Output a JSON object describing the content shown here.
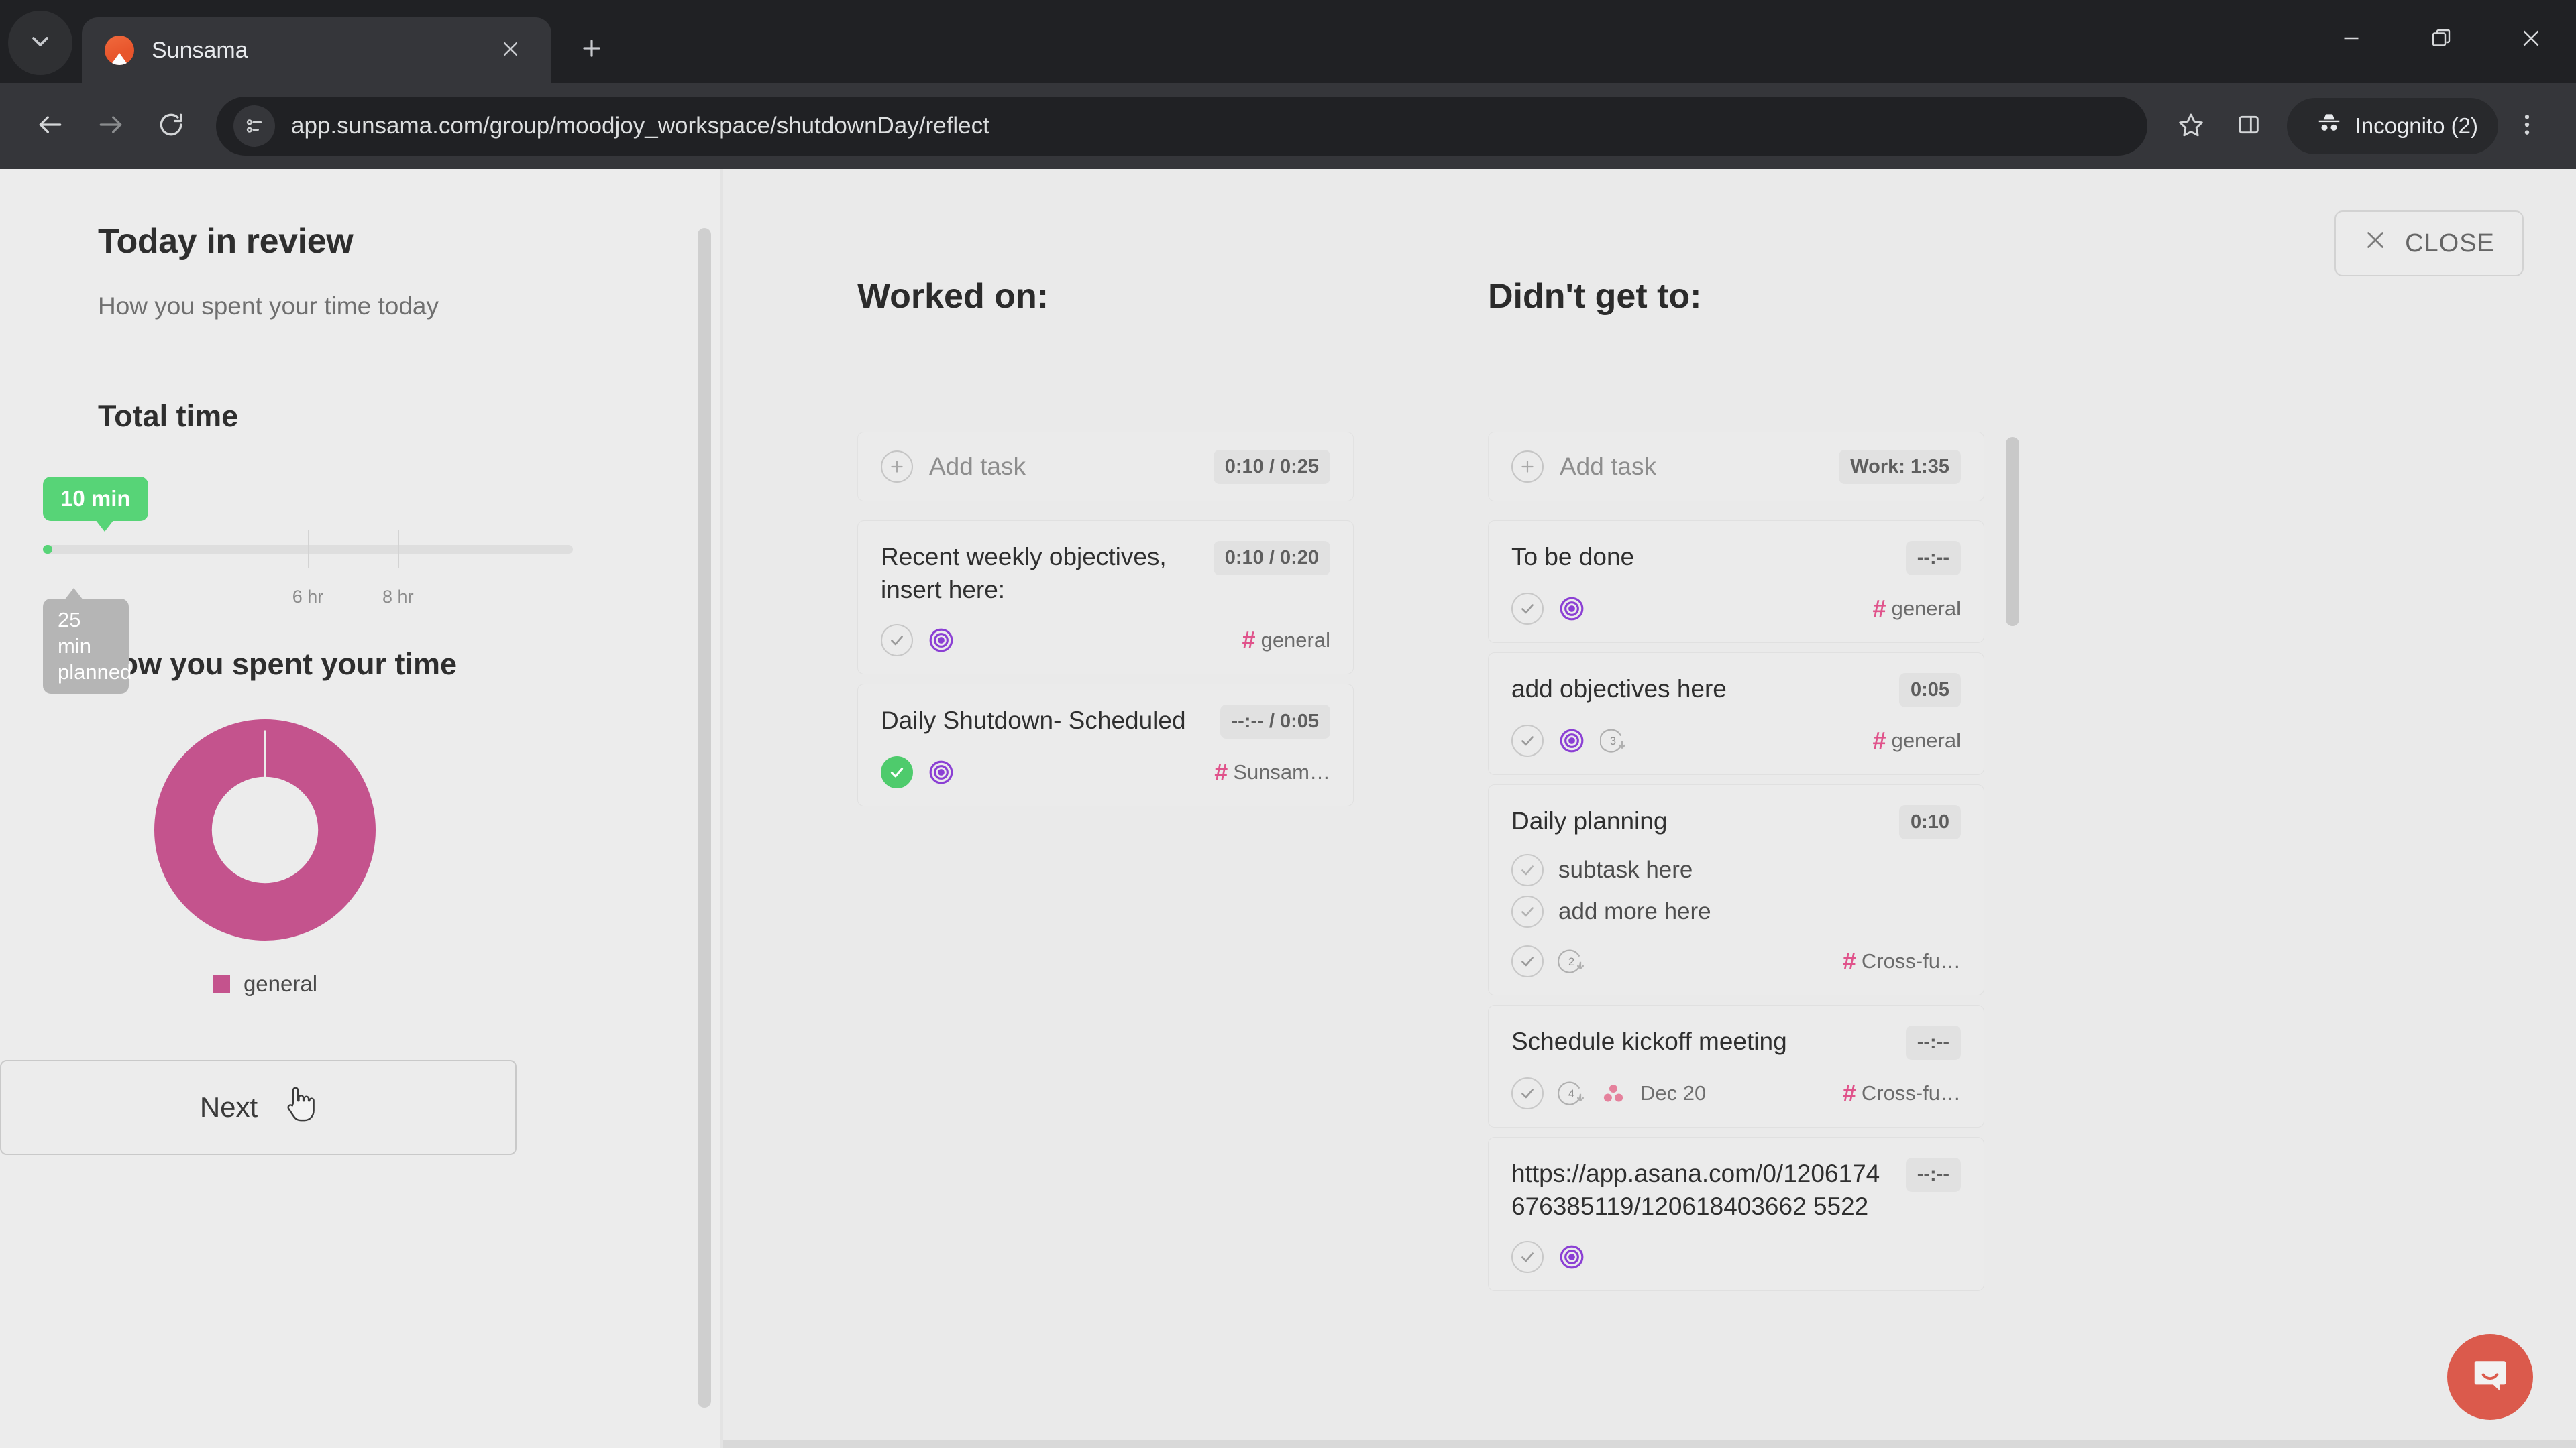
{
  "browser": {
    "tab": {
      "title": "Sunsama",
      "favicon_icon": "sunsama-logo-icon",
      "close_icon": "close-icon"
    },
    "tabsearch_icon": "chevron-down-icon",
    "newtab_icon": "plus-icon",
    "window": {
      "minimize": "minimize-icon",
      "maximize": "restore-icon",
      "close": "close-icon"
    },
    "nav": {
      "back_icon": "arrow-left-icon",
      "forward_icon": "arrow-right-icon",
      "reload_icon": "reload-icon"
    },
    "omnibox": {
      "site_icon": "page-info-icon",
      "url": "app.sunsama.com/group/moodjoy_workspace/shutdownDay/reflect"
    },
    "toolbar": {
      "bookmark_icon": "star-icon",
      "sidepanel_icon": "side-panel-icon",
      "profile_icon": "incognito-icon",
      "profile_label": "Incognito (2)",
      "menu_icon": "three-dot-menu-icon"
    }
  },
  "review": {
    "title": "Today in review",
    "subtitle": "How you spent your time today",
    "total_time_heading": "Total time",
    "slider": {
      "actual_label": "10 min",
      "planned_label": "25 min\nplanned",
      "planned_label_line1": "25 min",
      "planned_label_line2": "planned",
      "ticks": [
        {
          "label": "6 hr",
          "pct": 50
        },
        {
          "label": "8 hr",
          "pct": 67
        }
      ],
      "fill_pct": 2,
      "accent": "#57d477",
      "planned_color": "#b5b5b5"
    },
    "spent_heading": "How you spent your time",
    "next_label": "Next"
  },
  "chart_data": {
    "type": "pie",
    "title": "How you spent your time",
    "categories": [
      "general"
    ],
    "values": [
      10
    ],
    "value_unit": "minutes",
    "percentages": [
      100
    ],
    "colors": [
      "#c4538d"
    ],
    "legend": [
      "general"
    ],
    "legend_position": "bottom",
    "donut": true,
    "inner_radius_ratio": 0.45
  },
  "main": {
    "close_label": "CLOSE",
    "close_icon": "close-icon",
    "columns": [
      {
        "title": "Worked on:",
        "add_task_label": "Add task",
        "add_task_icon": "plus-circle-icon",
        "summary_chip": "0:10 / 0:25",
        "tasks": [
          {
            "title": "Recent weekly objectives, insert here:",
            "time_chip": "0:10 / 0:20",
            "checkbox": "unchecked",
            "has_target": true,
            "channel": "general",
            "subtasks": []
          },
          {
            "title": "Daily Shutdown- Scheduled",
            "time_chip": "--:-- / 0:05",
            "checkbox": "checked",
            "has_target": true,
            "channel": "Sunsam…",
            "subtasks": []
          }
        ]
      },
      {
        "title": "Didn't get to:",
        "add_task_label": "Add task",
        "add_task_icon": "plus-circle-icon",
        "summary_chip": "Work: 1:35",
        "tasks": [
          {
            "title": "To be done",
            "time_chip": "--:--",
            "checkbox": "unchecked",
            "has_target": true,
            "channel": "general",
            "subtasks": []
          },
          {
            "title": "add objectives here",
            "time_chip": "0:05",
            "checkbox": "unchecked",
            "has_target": true,
            "reschedule_count": "3",
            "channel": "general",
            "subtasks": []
          },
          {
            "title": "Daily planning",
            "time_chip": "0:10",
            "checkbox": "unchecked",
            "has_target": false,
            "reschedule_count": "2",
            "channel": "Cross-fu…",
            "subtasks": [
              "subtask here",
              "add more here"
            ]
          },
          {
            "title": "Schedule kickoff meeting",
            "time_chip": "--:--",
            "checkbox": "unchecked",
            "has_target": false,
            "reschedule_count": "4",
            "has_asana": true,
            "date": "Dec 20",
            "channel": "Cross-fu…",
            "subtasks": []
          },
          {
            "title": "https://app.asana.com/0/1206174676385119/120618403662 5522",
            "time_chip": "--:--",
            "checkbox": "unchecked",
            "has_target": false,
            "channel": "",
            "subtasks": []
          }
        ]
      }
    ]
  },
  "intercom": {
    "icon": "intercom-chat-icon",
    "color": "#db5a4c"
  }
}
